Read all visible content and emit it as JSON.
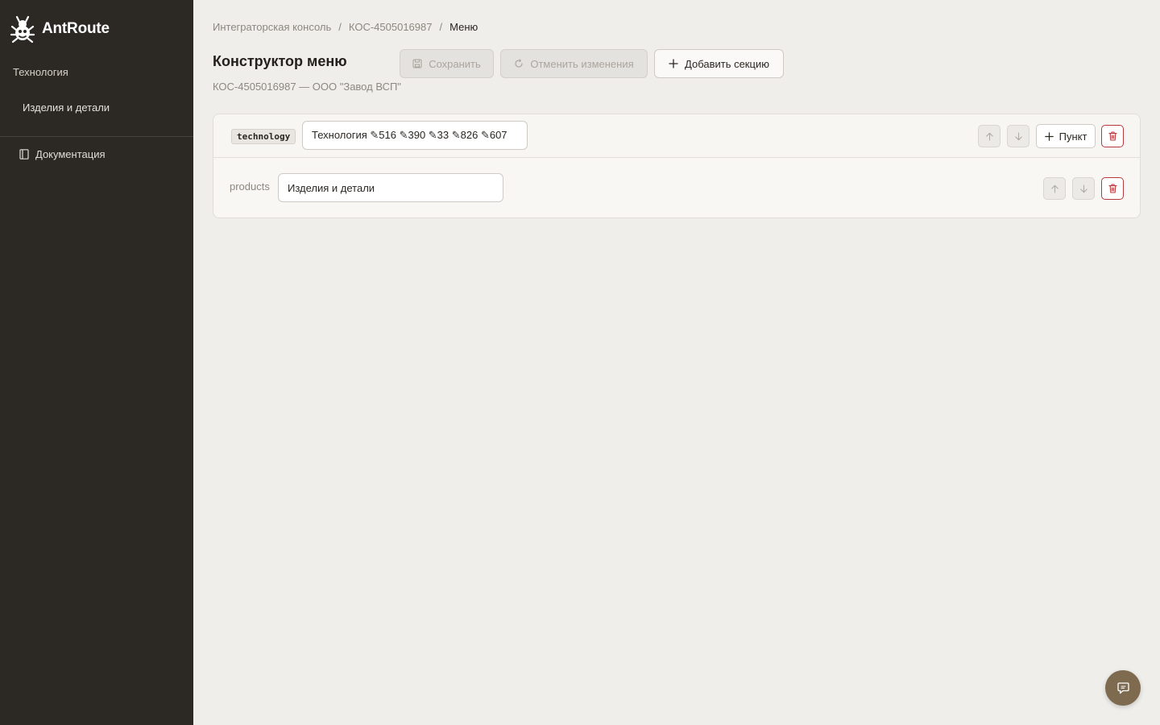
{
  "brand": {
    "name": "AntRoute"
  },
  "sidebar": {
    "section_label": "Технология",
    "items": [
      {
        "label": "Изделия и детали"
      }
    ],
    "docs_label": "Документация"
  },
  "breadcrumb": [
    {
      "label": "Интеграторская консоль"
    },
    {
      "label": "КОС-4505016987"
    },
    {
      "label": "Меню"
    }
  ],
  "page": {
    "title": "Конструктор меню",
    "subtitle": "КОС-4505016987 — ООО \"Завод ВСП\""
  },
  "toolbar": {
    "save_label": "Сохранить",
    "revert_label": "Отменить изменения",
    "add_section_label": "Добавить секцию"
  },
  "menu": {
    "sections": [
      {
        "key": "technology",
        "title": "Технология ✎516 ✎390 ✎33 ✎826 ✎607",
        "add_item_label": "Пункт",
        "items": [
          {
            "key": "products",
            "title": "Изделия и детали"
          }
        ]
      }
    ]
  },
  "colors": {
    "sidebar_bg": "#2c2824",
    "page_bg": "#efeeea",
    "danger": "#b8393d",
    "fab": "#7d6a4f"
  },
  "icons": {
    "logo": "ant-logo-icon",
    "docs": "document-icon",
    "save": "save-icon",
    "revert": "refresh-icon",
    "add": "plus-icon",
    "up": "arrow-up-icon",
    "down": "arrow-down-icon",
    "delete": "trash-icon",
    "chat": "chat-icon"
  }
}
